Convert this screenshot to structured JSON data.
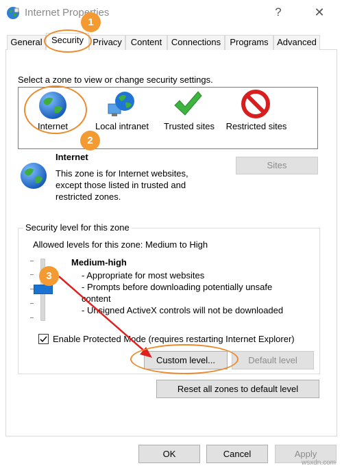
{
  "window": {
    "title": "Internet Properties",
    "help_label": "?",
    "close_label": "✕"
  },
  "tabs": [
    {
      "label": "General",
      "active": false
    },
    {
      "label": "Security",
      "active": true
    },
    {
      "label": "Privacy",
      "active": false
    },
    {
      "label": "Content",
      "active": false
    },
    {
      "label": "Connections",
      "active": false
    },
    {
      "label": "Programs",
      "active": false
    },
    {
      "label": "Advanced",
      "active": false
    }
  ],
  "security": {
    "zone_prompt": "Select a zone to view or change security settings.",
    "zones": [
      {
        "label": "Internet",
        "icon": "globe-icon",
        "selected": true
      },
      {
        "label": "Local intranet",
        "icon": "network-globe-icon",
        "selected": false
      },
      {
        "label": "Trusted sites",
        "icon": "checkmark-icon",
        "selected": false
      },
      {
        "label": "Restricted sites",
        "icon": "no-entry-icon",
        "selected": false
      }
    ],
    "selected_zone": {
      "name": "Internet",
      "description": "This zone is for Internet websites, except those listed in trusted and restricted zones."
    },
    "sites_label": "Sites",
    "level_group_title": "Security level for this zone",
    "allowed_levels": "Allowed levels for this zone: Medium to High",
    "level_name": "Medium-high",
    "level_bullets": [
      "- Appropriate for most websites",
      "- Prompts before downloading potentially unsafe",
      "content",
      "- Unsigned ActiveX controls will not be downloaded"
    ],
    "protected_mode_label": "Enable Protected Mode (requires restarting Internet Explorer)",
    "protected_mode_checked": true,
    "custom_level_label": "Custom level...",
    "default_level_label": "Default level",
    "reset_all_label": "Reset all zones to default level"
  },
  "footer": {
    "ok_label": "OK",
    "cancel_label": "Cancel",
    "apply_label": "Apply"
  },
  "annotations": {
    "step1": "1",
    "step2": "2",
    "step3": "3",
    "color": "#f39a33"
  },
  "watermark": "wsxdn.com",
  "colors": {
    "slider_thumb": "#1a73d0",
    "arrow": "#e02020",
    "callout": "#ec8a2e"
  }
}
